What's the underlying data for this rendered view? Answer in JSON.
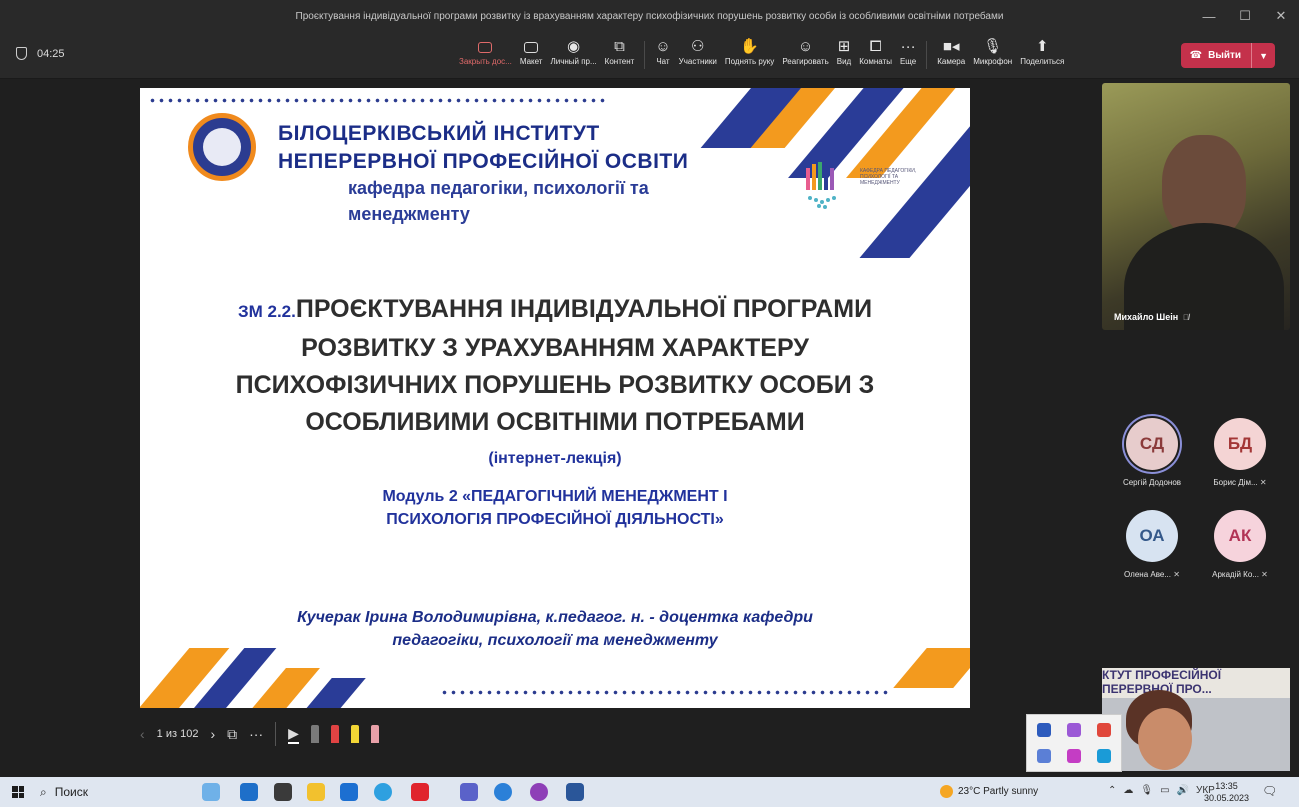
{
  "window": {
    "title": "Проєктування індивідуальної програми розвитку із врахуванням характеру психофізичних порушень розвитку особи із особливими освітніми потребами"
  },
  "toolbar": {
    "timer": "04:25",
    "close_content": "Закрыть дос...",
    "layout": "Макет",
    "personal": "Личный пр...",
    "content": "Контент",
    "chat": "Чат",
    "participants": "Участники",
    "raise_hand": "Поднять руку",
    "react": "Реагировать",
    "view": "Вид",
    "rooms": "Комнаты",
    "more": "Еще",
    "camera": "Камера",
    "mic": "Микрофон",
    "share": "Поделиться",
    "leave": "Выйти"
  },
  "slide": {
    "institute_line1": "БІЛОЦЕРКІВСЬКИЙ ІНСТИТУТ",
    "institute_line2": "НЕПЕРЕРВНОЇ ПРОФЕСІЙНОЇ ОСВІТИ",
    "dept_line1": "кафедра педагогіки, психології та",
    "dept_line2": "менеджменту",
    "dept_logo_text": "КАФЕДРА ПЕДАГОГІКИ, ПСИХОЛОГІЇ ТА МЕНЕДЖМЕНТУ",
    "code": "ЗМ 2.2.",
    "title_line1": "ПРОЄКТУВАННЯ ІНДИВІДУАЛЬНОЇ ПРОГРАМИ",
    "title_line2": "РОЗВИТКУ З УРАХУВАННЯМ ХАРАКТЕРУ",
    "title_line3": "ПСИХОФІЗИЧНИХ ПОРУШЕНЬ РОЗВИТКУ ОСОБИ З",
    "title_line4": "ОСОБЛИВИМИ ОСВІТНІМИ ПОТРЕБАМИ",
    "lecture_type": "(інтернет-лекція)",
    "module_line1": "Модуль 2 «ПЕДАГОГІЧНИЙ МЕНЕДЖМЕНТ І",
    "module_line2": "ПСИХОЛОГІЯ ПРОФЕСІЙНОЇ ДІЯЛЬНОСТІ»",
    "author_line1": "Кучерак Ірина Володимирівна, к.педагог. н. - доцентка кафедри",
    "author_line2": "педагогіки, психології та менеджменту"
  },
  "slide_controls": {
    "page": "1 из 102"
  },
  "video": {
    "name": "Михайло Шеін"
  },
  "participants": [
    {
      "initials": "СД",
      "name": "Сергій Додонов",
      "color": "#e7cccc",
      "text_color": "#8b3a3a",
      "ring": true
    },
    {
      "initials": "БД",
      "name": "Борис Дім...",
      "color": "#f4d4d4",
      "text_color": "#a33636",
      "ring": false
    },
    {
      "initials": "ОА",
      "name": "Олена Аве...",
      "color": "#d7e3f1",
      "text_color": "#35598a",
      "ring": false
    },
    {
      "initials": "АК",
      "name": "Аркадій Ко...",
      "color": "#f6d3dc",
      "text_color": "#b23355",
      "ring": false
    }
  ],
  "self_view": {
    "banner_line1": "КТУТ ПРОФЕСІЙНОЇ",
    "banner_line2": "ПЕРЕРВНОЇ ПРО..."
  },
  "taskbar": {
    "search": "Поиск",
    "weather": "23°C  Partly sunny",
    "lang": "УКР",
    "time": "13:35",
    "date": "30.05.2023",
    "notif_count": "4"
  }
}
